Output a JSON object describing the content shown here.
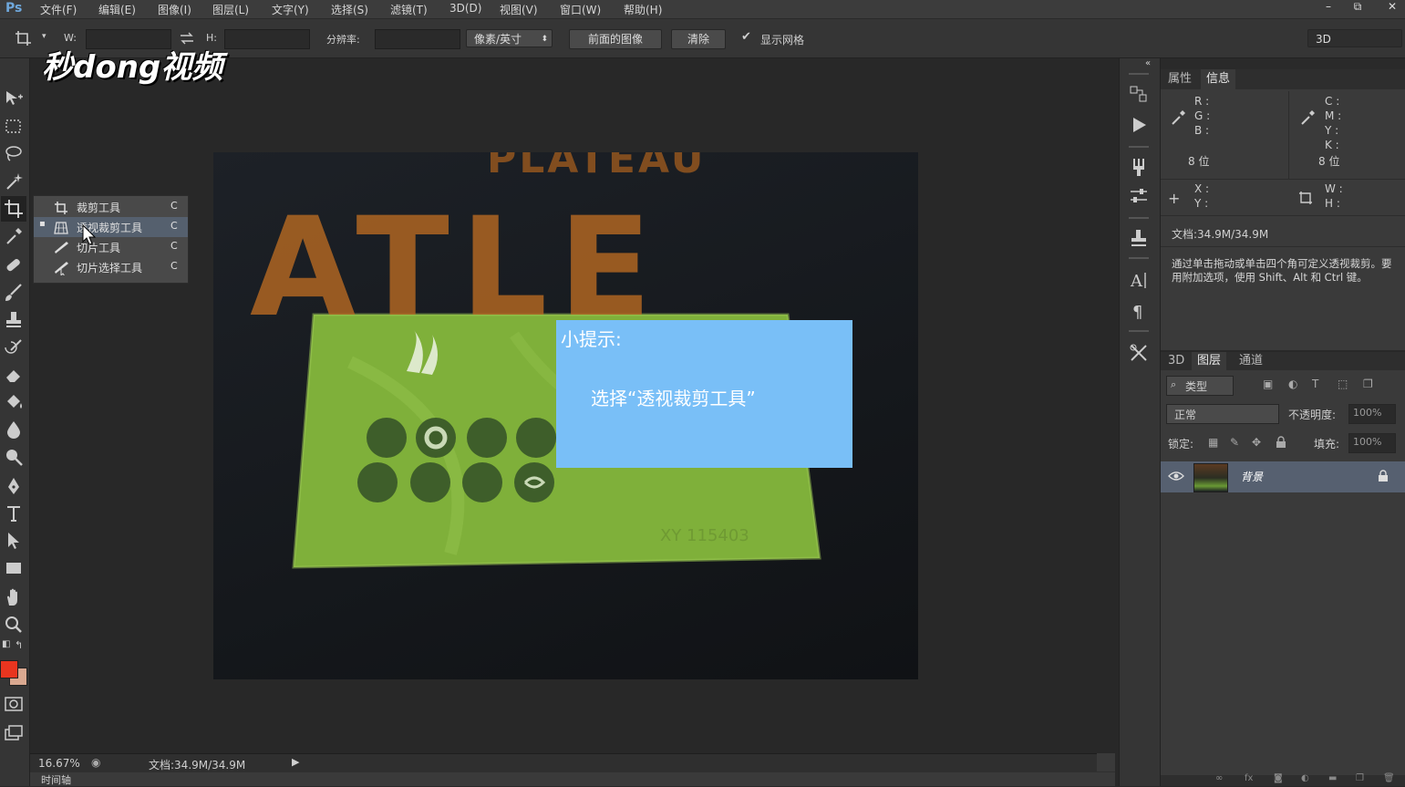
{
  "app": {
    "logo": "Ps"
  },
  "menu": [
    "文件(F)",
    "编辑(E)",
    "图像(I)",
    "图层(L)",
    "文字(Y)",
    "选择(S)",
    "滤镜(T)",
    "3D(D)",
    "视图(V)",
    "窗口(W)",
    "帮助(H)"
  ],
  "window_controls": [
    "–",
    "⧉",
    "✕"
  ],
  "options": {
    "w_label": "W:",
    "h_label": "H:",
    "resolution_label": "分辨率:",
    "unit_select": "像素/英寸",
    "front_image": "前面的图像",
    "clear": "清除",
    "show_grid": "显示网格",
    "workspace": "3D"
  },
  "watermark": "秒dong视频",
  "flyout": [
    {
      "label": "裁剪工具",
      "key": "C",
      "selected": false
    },
    {
      "label": "透视裁剪工具",
      "key": "C",
      "selected": true
    },
    {
      "label": "切片工具",
      "key": "C",
      "selected": false
    },
    {
      "label": "切片选择工具",
      "key": "C",
      "selected": false
    }
  ],
  "tip": {
    "title": "小提示:",
    "body": "选择“透视裁剪工具”"
  },
  "status": {
    "zoom": "16.67%",
    "doc": "文档:34.9M/34.9M"
  },
  "timeline_label": "时间轴",
  "props_panel": {
    "tabs": [
      "属性",
      "信息"
    ],
    "rgb": [
      "R :",
      "G :",
      "B :"
    ],
    "cmyk": [
      "C :",
      "M :",
      "Y :",
      "K :"
    ],
    "bits_left": "8 位",
    "bits_right": "8 位",
    "xy": [
      "X :",
      "Y :"
    ],
    "wh": [
      "W :",
      "H :"
    ],
    "doc": "文档:34.9M/34.9M",
    "hint": "通过单击拖动或单击四个角可定义透视裁剪。要用附加选项，使用 Shift、Alt 和 Ctrl 键。"
  },
  "layers_panel": {
    "tabs": [
      "3D",
      "图层",
      "通道"
    ],
    "filter": "类型",
    "blend": "正常",
    "opacity_label": "不透明度:",
    "opacity": "100%",
    "lock_label": "锁定:",
    "fill_label": "填充:",
    "fill": "100%",
    "layer_name": "背景"
  },
  "photo_text": {
    "top": "PLATEAU",
    "big": "ATLE",
    "card_number": "XY 115403"
  },
  "colors": {
    "foreground": "#e8351f",
    "background": "#d9a890",
    "tip_bg": "#79bff7",
    "card": "#7fb03a"
  }
}
